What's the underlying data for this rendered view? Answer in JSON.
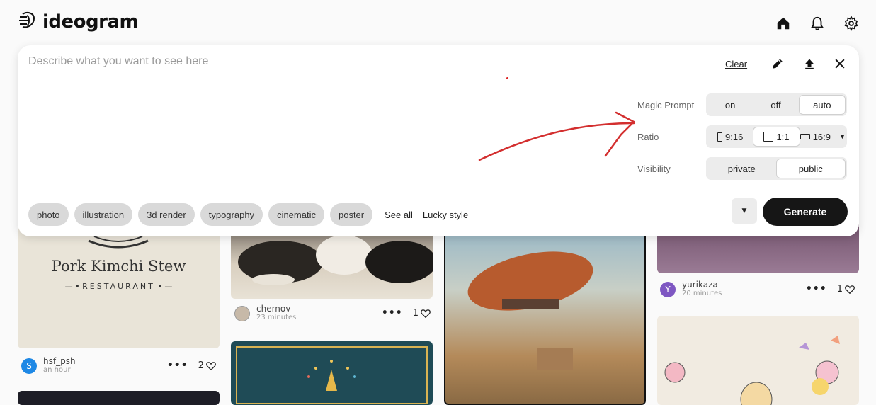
{
  "app": {
    "title": "ideogram"
  },
  "topbar": {
    "icons": [
      "home-icon",
      "bell-icon",
      "gear-icon"
    ]
  },
  "prompt": {
    "placeholder": "Describe what you want to see here",
    "value": ""
  },
  "actions": {
    "clear_label": "Clear",
    "icons": [
      "pencil-icon",
      "upload-icon",
      "close-icon"
    ]
  },
  "options": {
    "magic_prompt": {
      "label": "Magic Prompt",
      "choices": [
        "on",
        "off",
        "auto"
      ],
      "selected": "auto"
    },
    "ratio": {
      "label": "Ratio",
      "choices": [
        "9:16",
        "1:1",
        "16:9"
      ],
      "selected": "1:1"
    },
    "visibility": {
      "label": "Visibility",
      "choices": [
        "private",
        "public"
      ],
      "selected": "public"
    }
  },
  "styles": {
    "chips": [
      "photo",
      "illustration",
      "3d render",
      "typography",
      "cinematic",
      "poster"
    ],
    "see_all": "See all",
    "lucky": "Lucky style"
  },
  "generate_label": "Generate",
  "feed": {
    "cards": [
      {
        "image_title": "Pork Kimchi Stew",
        "image_subtitle": "RESTAURANT",
        "user": "hsf_psh",
        "avatar_letter": "S",
        "avatar_color": "#1e88e5",
        "time": "an hour",
        "likes": "2"
      },
      {
        "user": "chernov",
        "time": "23 minutes",
        "likes": "1"
      },
      {
        "user": "yurikaza",
        "avatar_letter": "Y",
        "avatar_color": "#7e57c2",
        "time": "20 minutes",
        "likes": "1"
      }
    ]
  },
  "colors": {
    "accent": "#161616",
    "annotation": "#d32f2f"
  }
}
